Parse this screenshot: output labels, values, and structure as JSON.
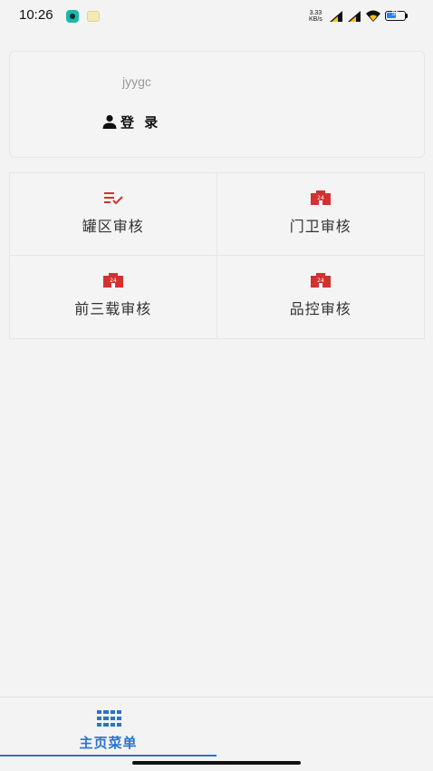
{
  "status_bar": {
    "time": "10:26",
    "net_speed_value": "3.33",
    "net_speed_unit": "KB/s",
    "battery_level": "55",
    "battery_fill_fraction": 0.55,
    "icons": [
      "app-notification-icon",
      "app-notification-icon-2",
      "signal-icon",
      "signal-icon",
      "wifi-icon",
      "battery-icon"
    ]
  },
  "user_card": {
    "username": "jyygc",
    "login_label": "登 录",
    "icon": "user-icon"
  },
  "menu": {
    "items": [
      {
        "label": "罐区审核",
        "icon": "checklist-icon"
      },
      {
        "label": "门卫审核",
        "icon": "building-24-icon"
      },
      {
        "label": "前三载审核",
        "icon": "building-24-icon"
      },
      {
        "label": "品控审核",
        "icon": "building-24-icon"
      }
    ],
    "icon_color": "#d3312f"
  },
  "bottom_nav": {
    "tabs": [
      {
        "label": "主页菜单",
        "icon": "grid-icon",
        "active": true
      }
    ],
    "accent_color": "#2a74c9"
  }
}
